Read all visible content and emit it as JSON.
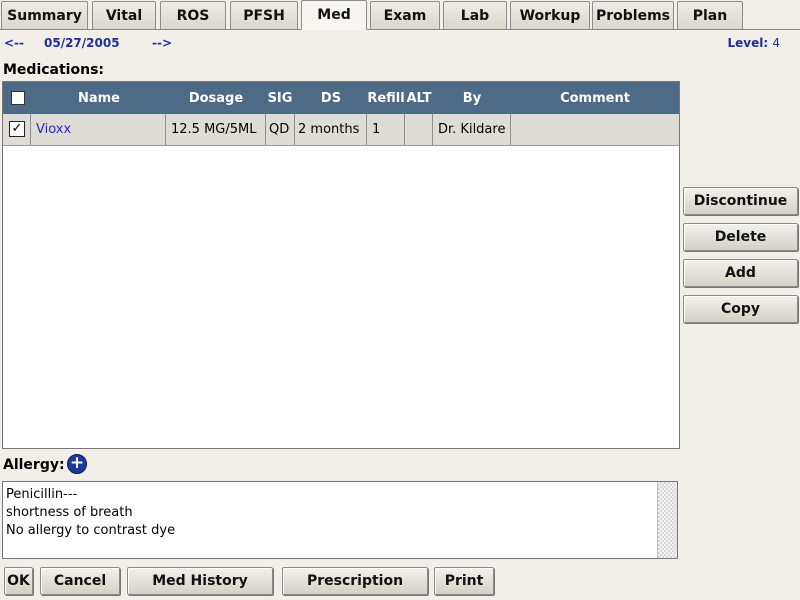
{
  "tabs": [
    {
      "label": "Summary",
      "active": false
    },
    {
      "label": "Vital",
      "active": false
    },
    {
      "label": "ROS",
      "active": false
    },
    {
      "label": "PFSH",
      "active": false
    },
    {
      "label": "Med",
      "active": true
    },
    {
      "label": "Exam",
      "active": false
    },
    {
      "label": "Lab",
      "active": false
    },
    {
      "label": "Workup",
      "active": false
    },
    {
      "label": "Problems",
      "active": false
    },
    {
      "label": "Plan",
      "active": false
    }
  ],
  "date_nav": {
    "prev": "<--",
    "date": "05/27/2005",
    "next": "-->"
  },
  "level": {
    "label": "Level:",
    "value": "4"
  },
  "medications": {
    "title": "Medications:",
    "columns": [
      "Name",
      "Dosage",
      "SIG",
      "DS",
      "Refill",
      "ALT",
      "By",
      "Comment"
    ],
    "rows": [
      {
        "checked": true,
        "check_glyph": "✓",
        "name": "Vioxx",
        "dosage": "12.5 MG/5ML",
        "sig": "QD",
        "ds": "2 months",
        "refill": "1",
        "alt": "",
        "by": "Dr. Kildare",
        "comment": ""
      }
    ]
  },
  "side_buttons": {
    "discontinue": "Discontinue",
    "delete": "Delete",
    "add": "Add",
    "copy": "Copy"
  },
  "allergy": {
    "title": "Allergy:",
    "add_glyph": "+",
    "lines": [
      "Penicillin---",
      "shortness of breath",
      "No allergy to contrast dye"
    ]
  },
  "bottom_buttons": {
    "ok": "OK",
    "cancel": "Cancel",
    "med_history": "Med History",
    "prescription": "Prescription",
    "print": "Print"
  },
  "colors": {
    "header_bg": "#4d6a86",
    "link": "#2a2ab8",
    "nav_text": "#1f2f99",
    "background": "#f1efe7"
  }
}
